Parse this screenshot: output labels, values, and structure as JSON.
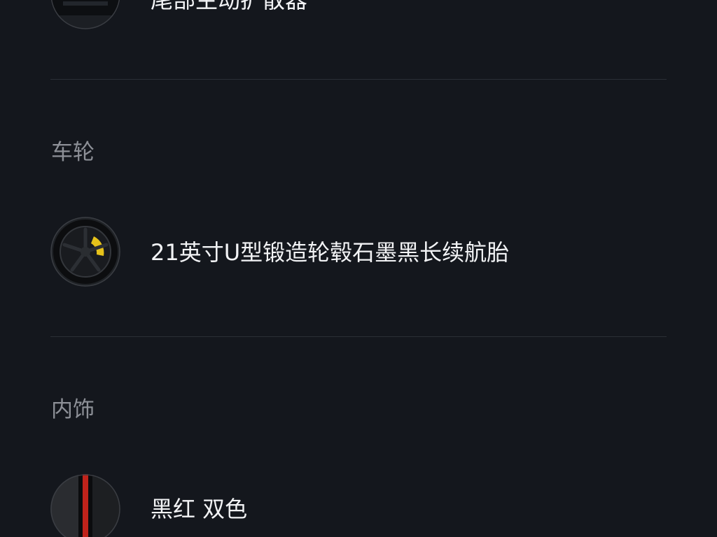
{
  "colors": {
    "background": "#14171d",
    "divider": "#2b2f36",
    "section_title": "#8d9097",
    "item_text": "#f2f3f5",
    "caliper_yellow": "#e6c21a",
    "stripe_red": "#c0231b"
  },
  "sections": [
    {
      "title": "",
      "item": {
        "label": "尾部主动扩散器",
        "icon": "rear-diffuser-thumbnail"
      }
    },
    {
      "title": "车轮",
      "item": {
        "label": "21英寸U型锻造轮毂石墨黑长续航胎",
        "icon": "wheel-thumbnail"
      }
    },
    {
      "title": "内饰",
      "item": {
        "label": "黑红 双色",
        "icon": "interior-color-swatch"
      }
    }
  ]
}
